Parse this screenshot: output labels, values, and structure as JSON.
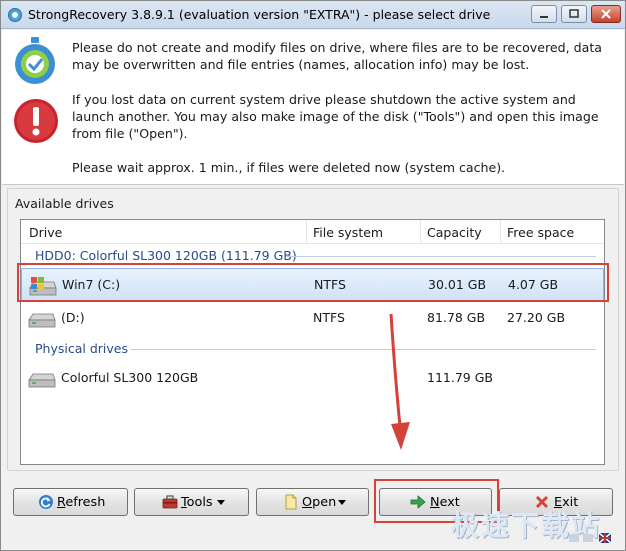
{
  "window": {
    "title": "StrongRecovery 3.8.9.1 (evaluation version \"EXTRA\") - please select drive"
  },
  "messages": {
    "line1": "Please do not create and modify files on drive, where files are to be recovered, data may be overwritten and file entries (names, allocation info) may be lost.",
    "line2": "If you lost data on current system drive please shutdown the active system and launch another. You may also make image of the disk (\"Tools\") and open this image from file (\"Open\").",
    "line3": "Please wait approx. 1 min., if files were deleted now (system cache)."
  },
  "drives_group": {
    "label": "Available drives",
    "columns": [
      "Drive",
      "File system",
      "Capacity",
      "Free space"
    ],
    "hdd_group_title": "HDD0: Colorful SL300 120GB  (111.79 GB)",
    "rows": [
      {
        "name": "Win7 (C:)",
        "fs": "NTFS",
        "capacity": "30.01 GB",
        "free": "4.07 GB"
      },
      {
        "name": "(D:)",
        "fs": "NTFS",
        "capacity": "81.78 GB",
        "free": "27.20 GB"
      }
    ],
    "physical_group_title": "Physical drives",
    "physical_rows": [
      {
        "name": "Colorful SL300 120GB",
        "fs": "",
        "capacity": "111.79 GB",
        "free": ""
      }
    ]
  },
  "buttons": {
    "refresh": {
      "first": "R",
      "rest": "efresh"
    },
    "tools": {
      "first": "T",
      "rest": "ools"
    },
    "open": {
      "first": "O",
      "rest": "pen"
    },
    "next": {
      "first": "N",
      "rest": "ext"
    },
    "exit": {
      "first": "E",
      "rest": "xit"
    }
  },
  "watermark": "极速下载站",
  "colors": {
    "highlight": "#d6413a",
    "accent": "#2a4a8a"
  }
}
